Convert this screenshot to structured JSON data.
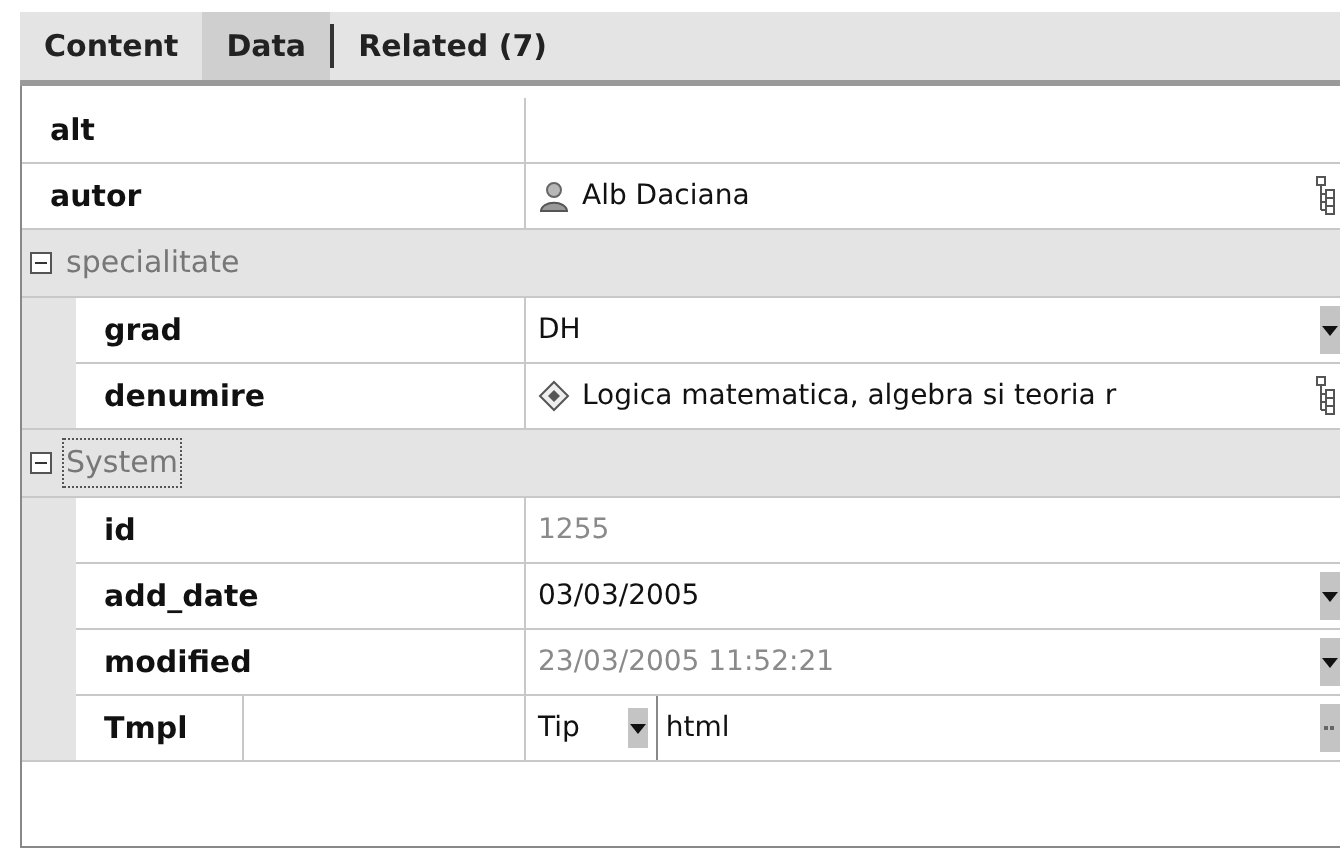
{
  "tabs": [
    {
      "label": "Content",
      "selected": false
    },
    {
      "label": "Data",
      "selected": true
    },
    {
      "label": "Related (7)",
      "selected": false
    }
  ],
  "properties": [
    {
      "kind": "blank",
      "name": "alt"
    },
    {
      "kind": "person",
      "name": "autor",
      "value": "Alb Daciana"
    },
    {
      "kind": "group",
      "name": "specialitate",
      "expanded": true,
      "focused": false,
      "children": [
        {
          "kind": "choice",
          "name": "grad",
          "value": "DH"
        },
        {
          "kind": "item",
          "name": "denumire",
          "value": "Logica matematica, algebra si teoria r"
        }
      ]
    },
    {
      "kind": "group",
      "name": "System",
      "expanded": true,
      "focused": true,
      "children": [
        {
          "kind": "text",
          "name": "id",
          "value": "1255",
          "disabled": true
        },
        {
          "kind": "choice",
          "name": "add_date",
          "value": "03/03/2005",
          "disabled": false
        },
        {
          "kind": "choice",
          "name": "modified",
          "value": "23/03/2005 11:52:21",
          "disabled": true
        },
        {
          "kind": "template",
          "name": "Tmpl",
          "type": "Tip",
          "value": "html"
        }
      ]
    }
  ]
}
